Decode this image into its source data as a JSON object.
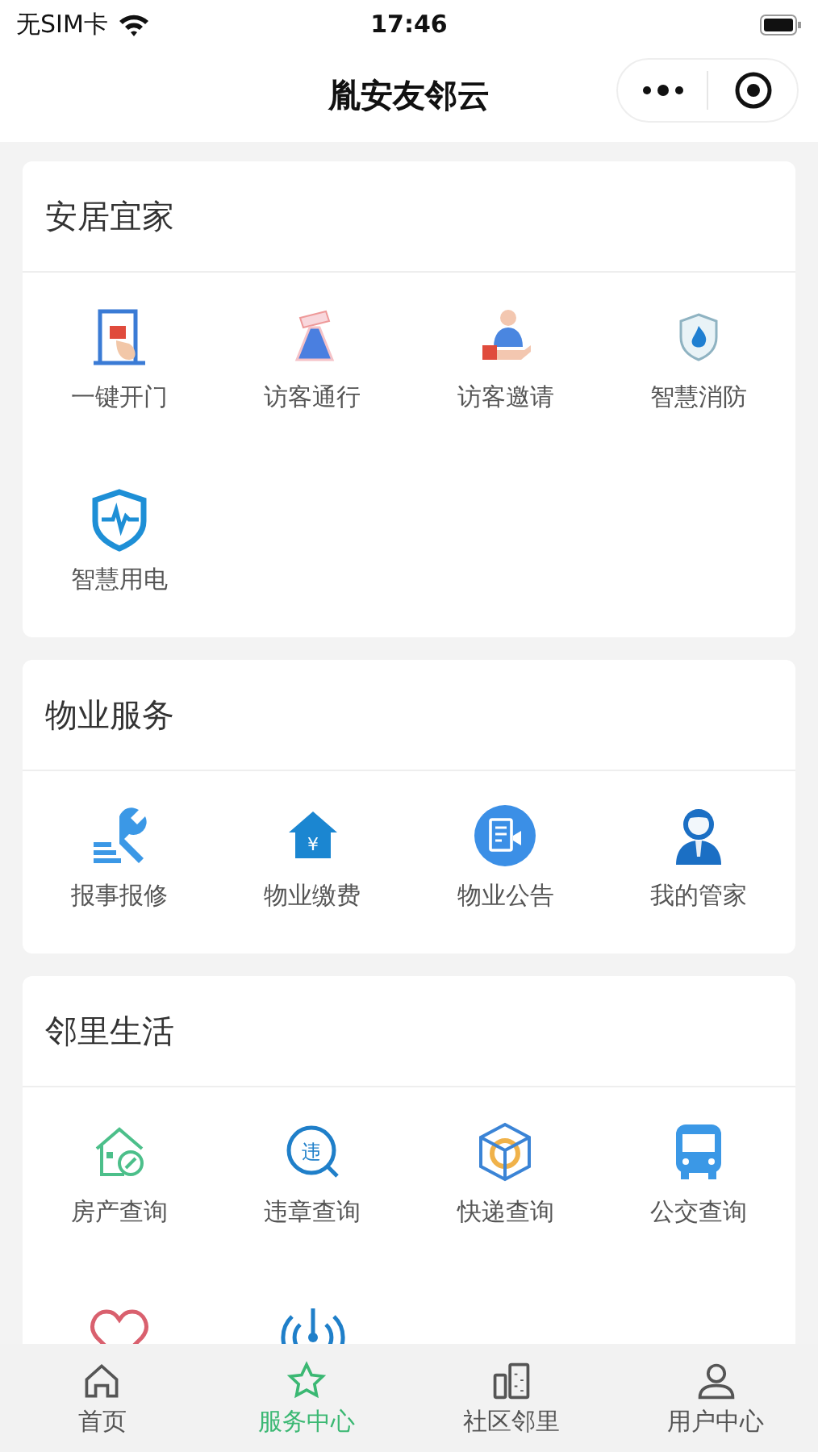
{
  "status_bar": {
    "carrier": "无SIM卡",
    "time": "17:46"
  },
  "nav_bar": {
    "title": "胤安友邻云"
  },
  "sections": [
    {
      "title": "安居宜家",
      "items": [
        {
          "label": "一键开门",
          "kind": "door"
        },
        {
          "label": "访客通行",
          "kind": "visitor"
        },
        {
          "label": "访客邀请",
          "kind": "invite"
        },
        {
          "label": "智慧消防",
          "kind": "fire"
        },
        {
          "label": "智慧用电",
          "kind": "power"
        }
      ]
    },
    {
      "title": "物业服务",
      "items": [
        {
          "label": "报事报修",
          "kind": "wrench"
        },
        {
          "label": "物业缴费",
          "kind": "fee",
          "glyph": "¥"
        },
        {
          "label": "物业公告",
          "kind": "notice"
        },
        {
          "label": "我的管家",
          "kind": "butler"
        }
      ]
    },
    {
      "title": "邻里生活",
      "items": [
        {
          "label": "房产查询",
          "kind": "housekey"
        },
        {
          "label": "违章查询",
          "kind": "violation",
          "glyph": "违"
        },
        {
          "label": "快递查询",
          "kind": "parcel"
        },
        {
          "label": "公交查询",
          "kind": "bus"
        },
        {
          "kind": "heart"
        },
        {
          "kind": "signal"
        }
      ]
    }
  ],
  "tabs": [
    {
      "label": "首页",
      "kind": "home",
      "selected": false
    },
    {
      "label": "服务中心",
      "kind": "star",
      "selected": true
    },
    {
      "label": "社区邻里",
      "kind": "building",
      "selected": false
    },
    {
      "label": "用户中心",
      "kind": "user",
      "selected": false
    }
  ]
}
